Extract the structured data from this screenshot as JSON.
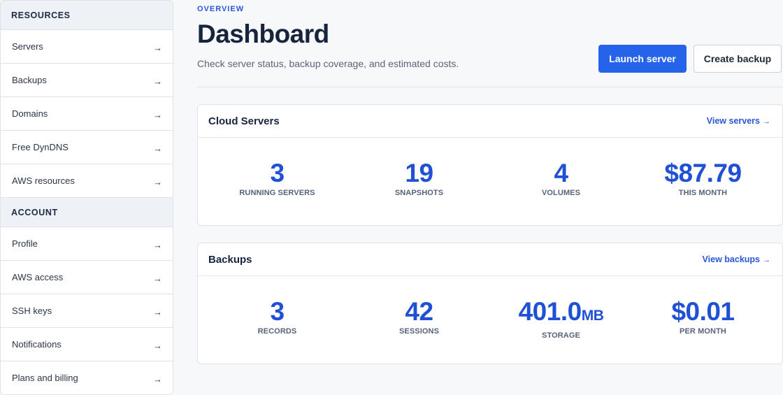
{
  "sidebar": {
    "sections": [
      {
        "heading": "RESOURCES",
        "items": [
          {
            "label": "Servers",
            "arrow": "→"
          },
          {
            "label": "Backups",
            "arrow": "→"
          },
          {
            "label": "Domains",
            "arrow": "→"
          },
          {
            "label": "Free DynDNS",
            "arrow": "→"
          },
          {
            "label": "AWS resources",
            "arrow": "→"
          }
        ]
      },
      {
        "heading": "ACCOUNT",
        "items": [
          {
            "label": "Profile",
            "arrow": "→"
          },
          {
            "label": "AWS access",
            "arrow": "→"
          },
          {
            "label": "SSH keys",
            "arrow": "→"
          },
          {
            "label": "Notifications",
            "arrow": "→"
          },
          {
            "label": "Plans and billing",
            "arrow": "→"
          }
        ]
      }
    ]
  },
  "header": {
    "eyebrow": "OVERVIEW",
    "title": "Dashboard",
    "subtitle": "Check server status, backup coverage, and estimated costs.",
    "primary_button": "Launch server",
    "secondary_button": "Create backup"
  },
  "cards": [
    {
      "title": "Cloud Servers",
      "link_label": "View servers",
      "link_arrow": "→",
      "stats": [
        {
          "value": "3",
          "unit": "",
          "label": "RUNNING SERVERS"
        },
        {
          "value": "19",
          "unit": "",
          "label": "SNAPSHOTS"
        },
        {
          "value": "4",
          "unit": "",
          "label": "VOLUMES"
        },
        {
          "value": "$87.79",
          "unit": "",
          "label": "THIS MONTH"
        }
      ]
    },
    {
      "title": "Backups",
      "link_label": "View backups",
      "link_arrow": "→",
      "stats": [
        {
          "value": "3",
          "unit": "",
          "label": "RECORDS"
        },
        {
          "value": "42",
          "unit": "",
          "label": "SESSIONS"
        },
        {
          "value": "401.0",
          "unit": "MB",
          "label": "STORAGE"
        },
        {
          "value": "$0.01",
          "unit": "",
          "label": "PER MONTH"
        }
      ]
    }
  ],
  "colors": {
    "accent": "#2563eb",
    "stat_value": "#2050d4",
    "page_background": "#f6f8fa"
  }
}
